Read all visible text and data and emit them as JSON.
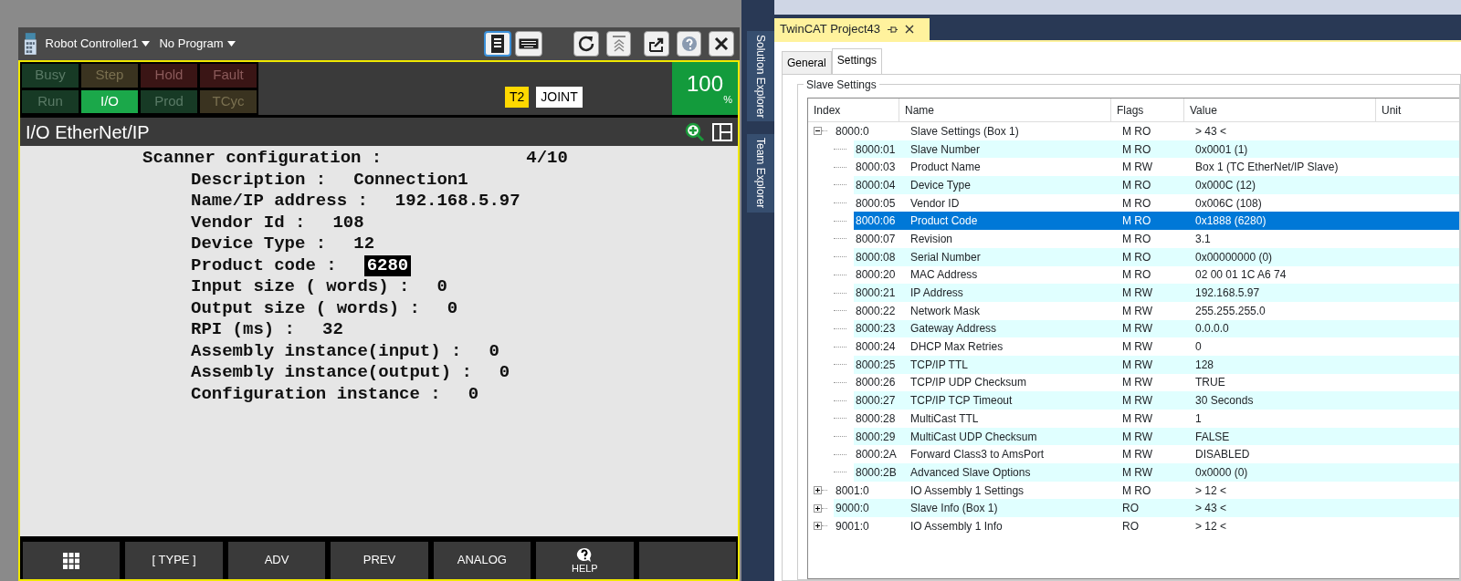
{
  "pendant": {
    "controller": "Robot Controller1",
    "program": "No Program",
    "views": [
      {
        "kind": "pendant",
        "selected": true
      },
      {
        "kind": "keyboard",
        "selected": false
      }
    ],
    "status_cells": [
      {
        "label": "Busy",
        "kind": "green",
        "on": false
      },
      {
        "label": "Step",
        "kind": "amber",
        "on": false
      },
      {
        "label": "Hold",
        "kind": "red",
        "on": false
      },
      {
        "label": "Fault",
        "kind": "red",
        "on": false
      },
      {
        "label": "Run",
        "kind": "green",
        "on": false
      },
      {
        "label": "I/O",
        "kind": "green",
        "on": true
      },
      {
        "label": "Prod",
        "kind": "green",
        "on": false
      },
      {
        "label": "TCyc",
        "kind": "amber",
        "on": false
      }
    ],
    "mode": "T2",
    "coord": "JOINT",
    "override": "100",
    "override_unit": "%",
    "screen_title": "I/O EtherNet/IP",
    "header": {
      "label": "Scanner configuration :",
      "value": "4/10"
    },
    "fields": [
      {
        "label": "Description :",
        "value": "Connection1",
        "selected": false
      },
      {
        "label": "Name/IP address :",
        "value": "192.168.5.97",
        "selected": false
      },
      {
        "label": "Vendor Id :",
        "value": "108",
        "selected": false
      },
      {
        "label": "Device Type :",
        "value": "12",
        "selected": false
      },
      {
        "label": "Product code :",
        "value": "6280",
        "selected": true
      },
      {
        "label": "Input size ( words) :",
        "value": "0",
        "selected": false
      },
      {
        "label": "Output size ( words) :",
        "value": "0",
        "selected": false
      },
      {
        "label": "RPI (ms) :",
        "value": "32",
        "selected": false
      },
      {
        "label": "Assembly instance(input) :",
        "value": "0",
        "selected": false
      },
      {
        "label": "Assembly instance(output) :",
        "value": "0",
        "selected": false
      },
      {
        "label": "Configuration instance :",
        "value": "0",
        "selected": false
      }
    ],
    "softkeys": [
      {
        "kind": "menu"
      },
      {
        "kind": "text",
        "label": "[ TYPE ]"
      },
      {
        "kind": "text",
        "label": "ADV"
      },
      {
        "kind": "text",
        "label": "PREV"
      },
      {
        "kind": "text",
        "label": "ANALOG"
      },
      {
        "kind": "help",
        "label": "HELP"
      },
      {
        "kind": "blank"
      }
    ]
  },
  "ide": {
    "side_tabs": [
      "Solution Explorer",
      "Team Explorer"
    ],
    "document_tab": "TwinCAT Project43",
    "tabs": [
      {
        "label": "General",
        "selected": false
      },
      {
        "label": "Settings",
        "selected": true
      }
    ],
    "group_title": "Slave Settings",
    "columns": [
      "Index",
      "Name",
      "Flags",
      "Value",
      "Unit"
    ],
    "rows": [
      {
        "index": "8000:0",
        "name": "Slave Settings (Box 1)",
        "flags": "M RO",
        "value": "> 43 <",
        "expanded": true,
        "selected": false,
        "children": [
          {
            "index": "8000:01",
            "name": "Slave Number",
            "flags": "M RO",
            "value": "0x0001 (1)",
            "selected": false
          },
          {
            "index": "8000:03",
            "name": "Product Name",
            "flags": "M RW",
            "value": "Box 1 (TC EtherNet/IP Slave)",
            "selected": false
          },
          {
            "index": "8000:04",
            "name": "Device Type",
            "flags": "M RO",
            "value": "0x000C (12)",
            "selected": false
          },
          {
            "index": "8000:05",
            "name": "Vendor ID",
            "flags": "M RO",
            "value": "0x006C (108)",
            "selected": false
          },
          {
            "index": "8000:06",
            "name": "Product Code",
            "flags": "M RO",
            "value": "0x1888 (6280)",
            "selected": true
          },
          {
            "index": "8000:07",
            "name": "Revision",
            "flags": "M RO",
            "value": "3.1",
            "selected": false
          },
          {
            "index": "8000:08",
            "name": "Serial Number",
            "flags": "M RO",
            "value": "0x00000000 (0)",
            "selected": false
          },
          {
            "index": "8000:20",
            "name": "MAC Address",
            "flags": "M RO",
            "value": "02 00 01 1C A6 74",
            "selected": false
          },
          {
            "index": "8000:21",
            "name": "IP Address",
            "flags": "M RW",
            "value": "192.168.5.97",
            "selected": false
          },
          {
            "index": "8000:22",
            "name": "Network Mask",
            "flags": "M RW",
            "value": "255.255.255.0",
            "selected": false
          },
          {
            "index": "8000:23",
            "name": "Gateway Address",
            "flags": "M RW",
            "value": "0.0.0.0",
            "selected": false
          },
          {
            "index": "8000:24",
            "name": "DHCP Max Retries",
            "flags": "M RW",
            "value": "0",
            "selected": false
          },
          {
            "index": "8000:25",
            "name": "TCP/IP TTL",
            "flags": "M RW",
            "value": "128",
            "selected": false
          },
          {
            "index": "8000:26",
            "name": "TCP/IP UDP Checksum",
            "flags": "M RW",
            "value": "TRUE",
            "selected": false
          },
          {
            "index": "8000:27",
            "name": "TCP/IP TCP Timeout",
            "flags": "M RW",
            "value": "30 Seconds",
            "selected": false
          },
          {
            "index": "8000:28",
            "name": "MultiCast TTL",
            "flags": "M RW",
            "value": "1",
            "selected": false
          },
          {
            "index": "8000:29",
            "name": "MultiCast UDP Checksum",
            "flags": "M RW",
            "value": "FALSE",
            "selected": false
          },
          {
            "index": "8000:2A",
            "name": "Forward Class3 to AmsPort",
            "flags": "M RW",
            "value": "DISABLED",
            "selected": false
          },
          {
            "index": "8000:2B",
            "name": "Advanced Slave Options",
            "flags": "M RW",
            "value": "0x0000 (0)",
            "selected": false
          }
        ]
      },
      {
        "index": "8001:0",
        "name": "IO Assembly 1 Settings",
        "flags": "M RO",
        "value": "> 12 <",
        "expanded": false,
        "selected": false
      },
      {
        "index": "9000:0",
        "name": "Slave Info (Box 1)",
        "flags": "RO",
        "value": "> 43 <",
        "expanded": false,
        "selected": false
      },
      {
        "index": "9001:0",
        "name": "IO Assembly 1 Info",
        "flags": "RO",
        "value": "> 12 <",
        "expanded": false,
        "selected": false
      }
    ]
  }
}
